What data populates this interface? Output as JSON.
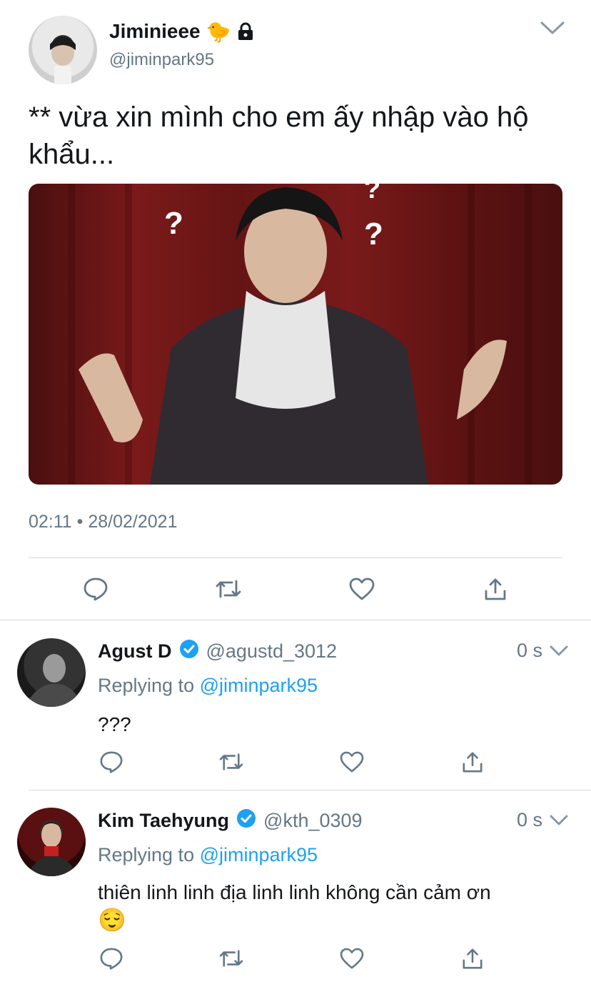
{
  "tweet": {
    "author": {
      "display_name": "Jiminieee",
      "handle": "@jiminpark95",
      "name_emoji": "🐤",
      "avatar": "avatar-white-hood"
    },
    "text": "** vừa xin mình cho em ấy nhập vào hộ khẩu...",
    "media": {
      "type": "image",
      "description": "meme-photo-questioning"
    },
    "timestamp": "02:11 • 28/02/2021",
    "actions": [
      "reply-icon",
      "retweet-icon",
      "like-icon",
      "share-icon"
    ]
  },
  "replies": [
    {
      "display_name": "Agust D",
      "handle": "@agustd_3012",
      "time": "0 s",
      "replying_prefix": "Replying to ",
      "replying_handle": "@jiminpark95",
      "text": "???",
      "emoji": "",
      "verified": true
    },
    {
      "display_name": "Kim Taehyung",
      "handle": "@kth_0309",
      "time": "0 s",
      "replying_prefix": "Replying to ",
      "replying_handle": "@jiminpark95",
      "text": "thiên linh linh địa linh linh không cần cảm ơn",
      "emoji": "😌",
      "verified": true
    }
  ],
  "colors": {
    "link": "#1da1f2",
    "muted": "#657786",
    "verified": "#1da1f2",
    "divider": "#d4d9dd"
  }
}
